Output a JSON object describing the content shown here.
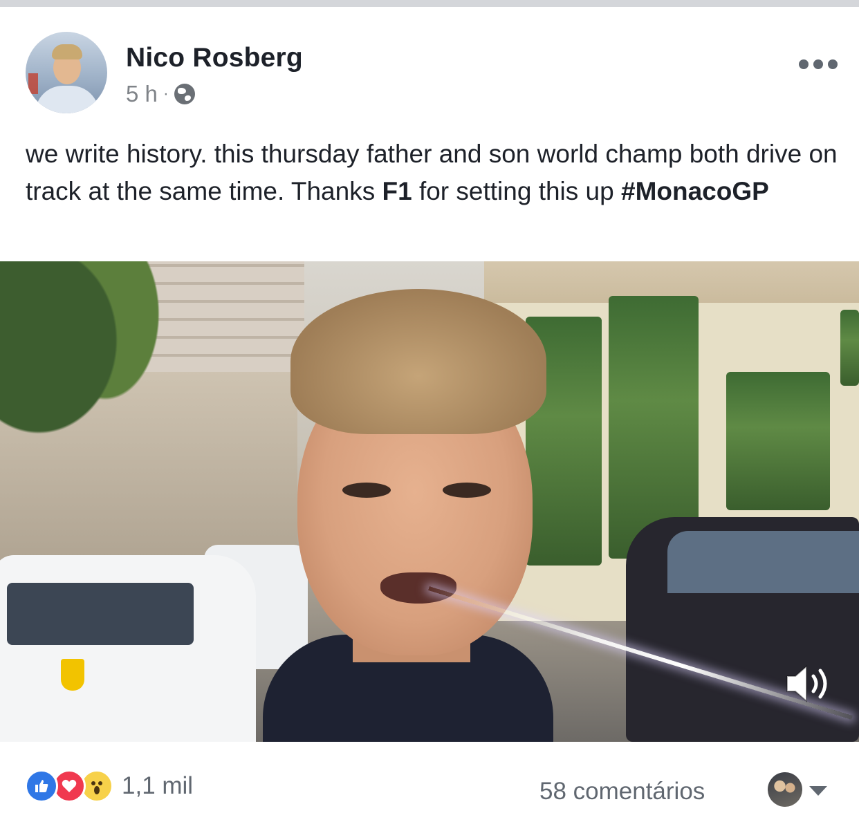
{
  "post": {
    "author": "Nico Rosberg",
    "time": "5 h",
    "separator": "·",
    "privacy_icon": "globe-icon",
    "more_icon": "more-horizontal-icon",
    "text_parts": {
      "p1": "we write history. this thursday father and son world champ both drive on track at the same time. Thanks ",
      "bold1": "F1",
      "p2": " for setting this up ",
      "bold2": "#MonacoGP"
    }
  },
  "video": {
    "sound_icon": "speaker-volume-icon"
  },
  "footer": {
    "reaction_icons": [
      "like-icon",
      "love-icon",
      "wow-icon"
    ],
    "reactions_count": "1,1 mil",
    "comments": "58 comentários",
    "dropdown_icon": "caret-down-icon"
  },
  "colors": {
    "top_bar": "#d4d6da",
    "like": "#2f77e6",
    "love": "#f0394f",
    "wow": "#f7d14a",
    "text_primary": "#1d2129",
    "text_secondary": "#606770"
  }
}
